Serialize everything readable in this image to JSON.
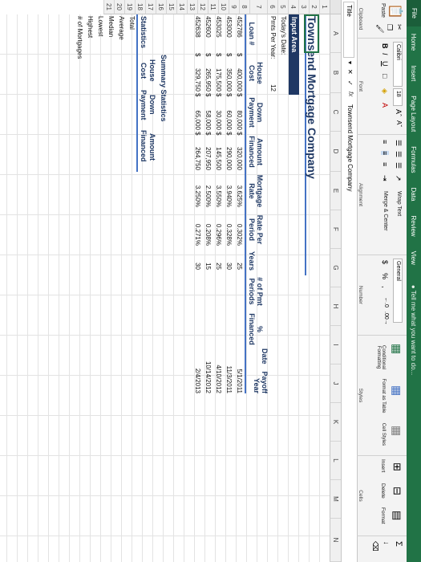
{
  "ribbon": {
    "tabs": [
      "File",
      "Home",
      "Insert",
      "Page Layout",
      "Formulas",
      "Data",
      "Review",
      "View"
    ],
    "tell_me": "Tell me what you want to do...",
    "clipboard": {
      "paste": "Paste",
      "label": "Clipboard"
    },
    "font": {
      "name": "Calibri",
      "size": "18",
      "label": "Font"
    },
    "alignment": {
      "wrap": "Wrap Text",
      "merge": "Merge & Center",
      "label": "Alignment"
    },
    "number": {
      "format": "General",
      "label": "Number"
    },
    "styles": {
      "conditional": "Conditional Formatting",
      "format_table": "Format as Table",
      "cell_styles": "Cell Styles",
      "label": "Styles"
    },
    "cells": {
      "insert": "Insert",
      "delete": "Delete",
      "format": "Format",
      "label": "Cells"
    }
  },
  "formula_bar": {
    "name_box": "Title",
    "fx": "fx",
    "content": "Townsend Mortgage Company"
  },
  "columns": [
    "A",
    "B",
    "C",
    "D",
    "E",
    "F",
    "G",
    "H",
    "I",
    "J",
    "K",
    "L",
    "M",
    "N"
  ],
  "rows": [
    "1",
    "2",
    "3",
    "4",
    "5",
    "6",
    "7",
    "8",
    "9",
    "10",
    "11",
    "12",
    "13",
    "14",
    "15",
    "16",
    "17",
    "18",
    "19",
    "20",
    "21"
  ],
  "sheet": {
    "title": "Townsend Mortgage Company",
    "input_area": "Input Area",
    "todays_date": "Today's Date:",
    "pmts_per_year": "Pmts Per Year:",
    "pmts_per_year_value": "12",
    "headers": {
      "loan_line1": "Loan #",
      "house_line1": "House",
      "house_line2": "Cost",
      "down_line1": "Down",
      "down_line2": "Payment",
      "amount_line1": "Amount",
      "amount_line2": "Financed",
      "rate_line1": "Mortgage",
      "rate_line2": "Rate",
      "rateper_line1": "Rate Per",
      "rateper_line2": "Period",
      "years_line1": "",
      "years_line2": "Years",
      "pmt_line1": "# of Pmt",
      "pmt_line2": "Periods",
      "pct_line1": "%",
      "pct_line2": "Financed",
      "payoff_line1": "Date",
      "payoff_line2": "Payoff",
      "payoff_line3": "Year"
    },
    "currency_symbol": "$",
    "loans": [
      {
        "loan": "452786",
        "house": "400,000",
        "down": "80,000",
        "amount": "320,000",
        "rate": "3.625%",
        "rateper": "0.302%",
        "years": "25",
        "pmts": "",
        "pct": "",
        "date": "5/1/2011"
      },
      {
        "loan": "453000",
        "house": "350,000",
        "down": "60,000",
        "amount": "290,000",
        "rate": "3.940%",
        "rateper": "0.328%",
        "years": "30",
        "pmts": "",
        "pct": "",
        "date": "11/3/2011"
      },
      {
        "loan": "453025",
        "house": "175,500",
        "down": "30,000",
        "amount": "145,500",
        "rate": "3.550%",
        "rateper": "0.296%",
        "years": "25",
        "pmts": "",
        "pct": "",
        "date": "4/10/2012"
      },
      {
        "loan": "452600",
        "house": "265,950",
        "down": "58,000",
        "amount": "207,950",
        "rate": "2.500%",
        "rateper": "0.208%",
        "years": "15",
        "pmts": "",
        "pct": "",
        "date": "10/14/2012"
      },
      {
        "loan": "452638",
        "house": "329,750",
        "down": "65,000",
        "amount": "264,750",
        "rate": "3.250%",
        "rateper": "0.271%",
        "years": "30",
        "pmts": "",
        "pct": "",
        "date": "2/4/2013"
      }
    ],
    "summary": {
      "title": "Summary Statistics",
      "col_house_1": "House",
      "col_house_2": "Cost",
      "col_down_1": "Down",
      "col_down_2": "Payment",
      "col_amount_1": "Amount",
      "col_amount_2": "Financed",
      "statistics": "Statistics",
      "rows": [
        "Total",
        "Average",
        "Median",
        "Lowest",
        "Highest",
        "# of Mortgages"
      ]
    }
  },
  "colors": {
    "excel_green": "#217346",
    "header_navy": "#1f3864",
    "accent_blue": "#4472c4"
  }
}
